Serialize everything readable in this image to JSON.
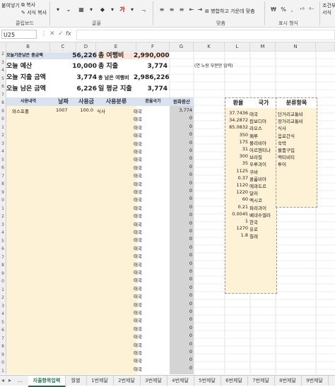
{
  "ribbon": {
    "paste_format_label": "붙여넣기",
    "copy_label": "복사",
    "format_copy_label": "서식 복사",
    "clipboard_group": "클립보드",
    "font_group": "글꼴",
    "align_group": "맞춤",
    "merge_label": "병합하고 가운데 맞춤",
    "number_group": "표시 형식",
    "percent_label": "%",
    "comma_label": ",",
    "right_cut_label": "조건부\n서식"
  },
  "formula_bar": {
    "name_box": "U25",
    "cancel_symbol": "✕",
    "enter_symbol": "✓",
    "fx_symbol": "fx",
    "value": ""
  },
  "columns": [
    "A",
    "B",
    "C",
    "D",
    "E",
    "F",
    "G",
    "K",
    "L",
    "M",
    "N"
  ],
  "summary": {
    "row1": {
      "label": "오늘기준남은 총금액",
      "value": "56,226",
      "label2": "총 여행비",
      "value2": "2,990,000"
    },
    "row2": {
      "label": "오늘 예산",
      "value": "10,000",
      "label2": "총 지출",
      "value2": "3,774",
      "note": "(연 노랑 부분만 입력)"
    },
    "row3": {
      "label": "오늘 지출 금액",
      "value": "3,774",
      "label2": "총 남은 여행비",
      "value2": "2,986,226"
    },
    "row4": {
      "label": "오늘 남은 금액",
      "value": "6,226",
      "label2": "일 평균 지출",
      "value2": "3,774"
    }
  },
  "table": {
    "headers": [
      "사용내역",
      "날짜",
      "사용금액",
      "사용분류",
      "환율국가",
      "원화환산"
    ],
    "first_row": {
      "desc": "와스포롤",
      "date": "1007",
      "amount": "100.0",
      "category": "식사",
      "country": "태국",
      "krw": "3,774"
    },
    "empty_country": "태국",
    "empty_krw": "0"
  },
  "rate_table": {
    "header1": "환율",
    "header2": "국가",
    "rows": [
      {
        "rate": "37.7436",
        "country": "태국"
      },
      {
        "rate": "34.2872",
        "country": "캄보디아"
      },
      {
        "rate": "85.0832",
        "country": "라오스"
      },
      {
        "rate": "350",
        "country": "페루"
      },
      {
        "rate": "175",
        "country": "볼리비아"
      },
      {
        "rate": "31",
        "country": "아르헨티나"
      },
      {
        "rate": "300",
        "country": "브라질"
      },
      {
        "rate": "35",
        "country": "우루과이"
      },
      {
        "rate": "1125",
        "country": "쿠바"
      },
      {
        "rate": "0.37",
        "country": "콜롬비아"
      },
      {
        "rate": "1120",
        "country": "에콰도르"
      },
      {
        "rate": "1220",
        "country": "달러"
      },
      {
        "rate": "60",
        "country": "멕시코"
      },
      {
        "rate": "0.21",
        "country": "파라과이"
      },
      {
        "rate": "0.0045",
        "country": "베네수엘라"
      },
      {
        "rate": "1",
        "country": "한국"
      },
      {
        "rate": "1270",
        "country": "유로"
      },
      {
        "rate": "1.8",
        "country": "칠레"
      }
    ]
  },
  "category_table": {
    "header": "분류항목",
    "rows": [
      "단거리교통비",
      "장거리교통비",
      "식사",
      "음료간식",
      "숙박",
      "물품구입",
      "액티비티",
      "투어"
    ]
  },
  "tabs": [
    "지출항목입력",
    "월별",
    "1번제달",
    "2번제달",
    "3번제달",
    "4번제달",
    "5번제달",
    "6번제달",
    "7번제달",
    "8번제달",
    "9번제달"
  ],
  "colors": {
    "yellow": "#fdf1d6",
    "header_blue": "#d9e3f0",
    "green": "#1e7145"
  }
}
